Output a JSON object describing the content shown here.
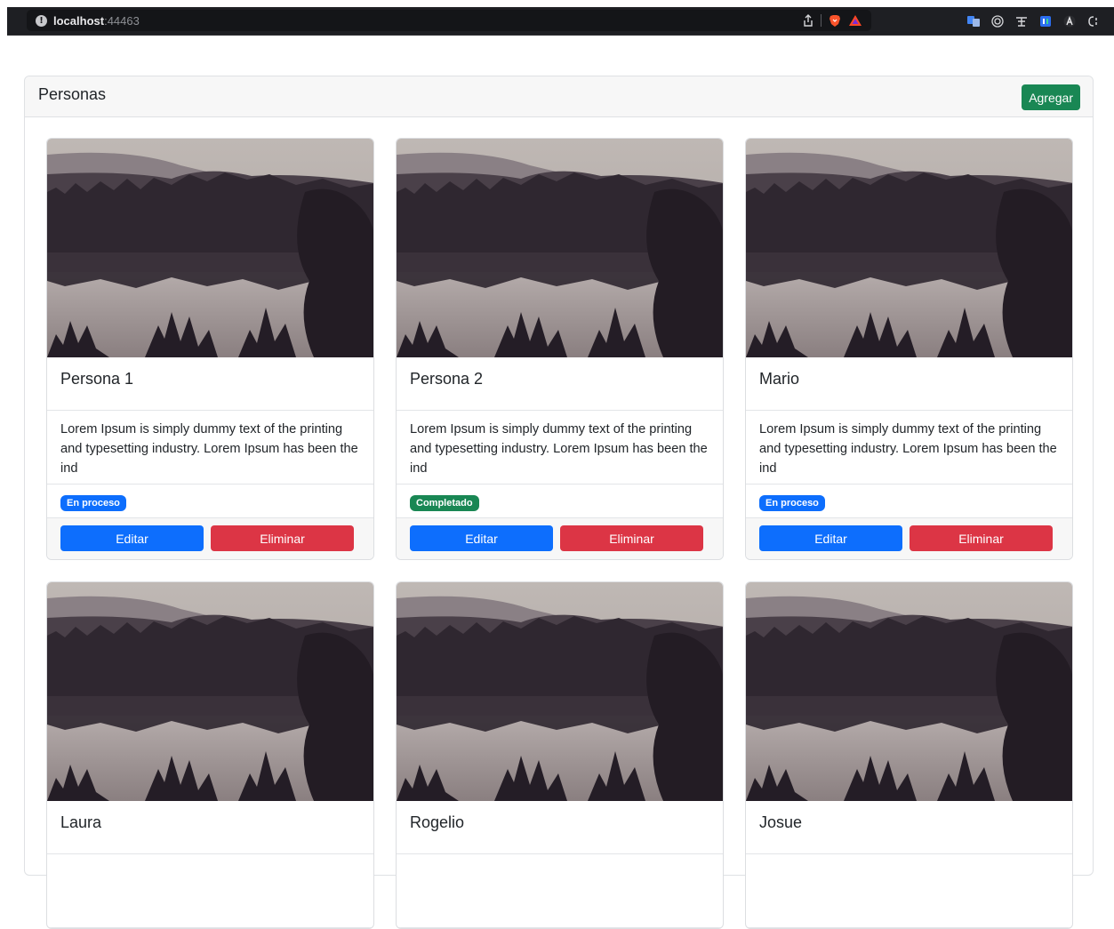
{
  "browser": {
    "url_host": "localhost",
    "url_port": ":44463",
    "extensions": [
      "translate-icon",
      "target-icon",
      "text-icon",
      "layers-icon",
      "font-icon",
      "code-icon"
    ]
  },
  "page": {
    "title": "Personas",
    "add_label": "Agregar"
  },
  "status_colors": {
    "En proceso": "#0d6efd",
    "Completado": "#198754"
  },
  "cards": [
    {
      "name": "Persona 1",
      "description": "Lorem Ipsum is simply dummy text of the printing and typesetting industry. Lorem Ipsum has been the ind",
      "status": "En proceso",
      "edit_label": "Editar",
      "delete_label": "Eliminar"
    },
    {
      "name": "Persona 2",
      "description": "Lorem Ipsum is simply dummy text of the printing and typesetting industry. Lorem Ipsum has been the ind",
      "status": "Completado",
      "edit_label": "Editar",
      "delete_label": "Eliminar"
    },
    {
      "name": "Mario",
      "description": "Lorem Ipsum is simply dummy text of the printing and typesetting industry. Lorem Ipsum has been the ind",
      "status": "En proceso",
      "edit_label": "Editar",
      "delete_label": "Eliminar"
    },
    {
      "name": "Laura"
    },
    {
      "name": "Rogelio"
    },
    {
      "name": "Josue"
    }
  ]
}
